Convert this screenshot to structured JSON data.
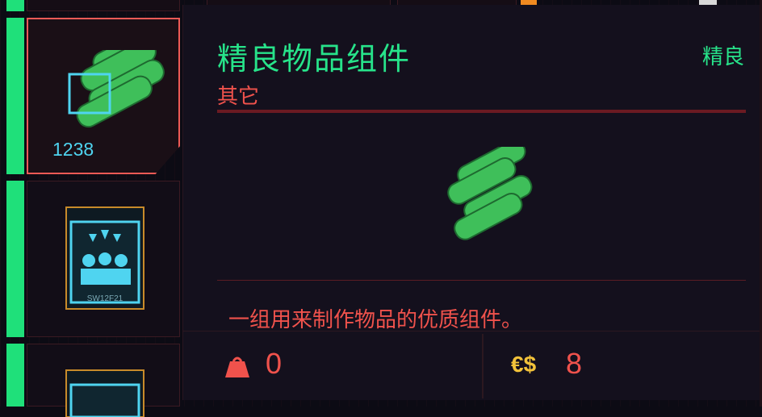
{
  "item": {
    "name": "精良物品组件",
    "quality": "精良",
    "category": "其它",
    "description": "一组用来制作物品的优质组件。",
    "weight": "0",
    "price": "8",
    "currency_symbol": "€$"
  },
  "inventory": {
    "selected_count": "1238",
    "shard_label": "SW12F21"
  },
  "colors": {
    "accent_green": "#27e38a",
    "accent_red": "#f0524c",
    "accent_cyan": "#4fd4f0",
    "currency_gold": "#f2c23a"
  }
}
